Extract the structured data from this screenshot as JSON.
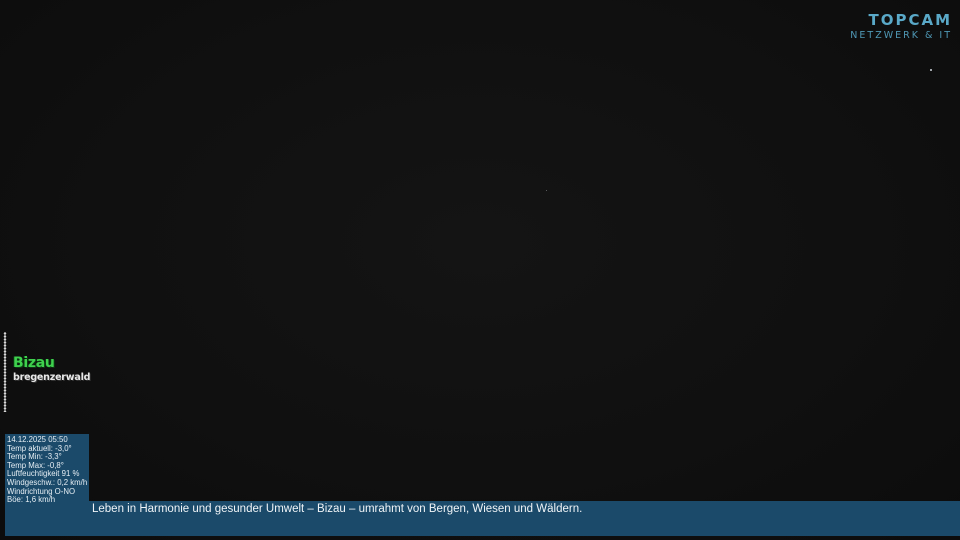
{
  "logo": {
    "main": "TOPCAM",
    "sub": "NETZWERK & IT"
  },
  "emblem": {
    "title": "Bizau",
    "subtitle": "bregenzerwald"
  },
  "weather": {
    "datetime": "14.12.2025 05:50",
    "temp_current": "Temp aktuell: -3,0°",
    "temp_min": "Temp Min: -3,3°",
    "temp_max": "Temp Max: -0,8°",
    "humidity": "Luftfeuchtigkeit 91 %",
    "wind_speed": "Windgeschw.: 0,2 km/h",
    "wind_direction": "Windrichtung O-NO",
    "gust": "Böe: 1,6 km/h"
  },
  "banner": {
    "text": "Leben in Harmonie und gesunder Umwelt – Bizau – umrahmt von Bergen, Wiesen und Wäldern."
  },
  "colors": {
    "logo": "#5aa9c8",
    "emblem_green": "#3fd14e",
    "panel_blue": "#1b4a6a"
  }
}
